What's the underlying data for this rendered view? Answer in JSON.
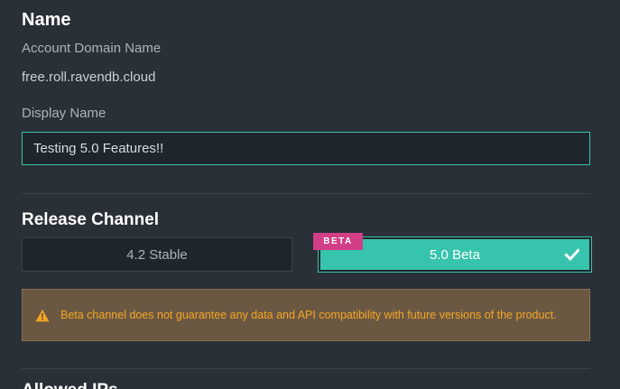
{
  "name_section": {
    "heading": "Name",
    "domain_label": "Account Domain Name",
    "domain_value": "free.roll.ravendb.cloud",
    "display_label": "Display Name",
    "display_value": "Testing 5.0 Features!!"
  },
  "release_section": {
    "heading": "Release Channel",
    "options": [
      {
        "label": "4.2 Stable",
        "selected": false
      },
      {
        "label": "5.0 Beta",
        "selected": true
      }
    ],
    "badge": "BETA",
    "warning": "Beta channel does not guarantee any data and API compatibility with future versions of the product."
  },
  "next_section": {
    "heading": "Allowed IPs"
  },
  "colors": {
    "accent": "#37c4ac",
    "badge": "#d23f86",
    "warning_bg": "#6b5843",
    "warning_text": "#f5a623"
  },
  "icons": {
    "selected": "check-icon",
    "warning": "warning-triangle-icon"
  }
}
